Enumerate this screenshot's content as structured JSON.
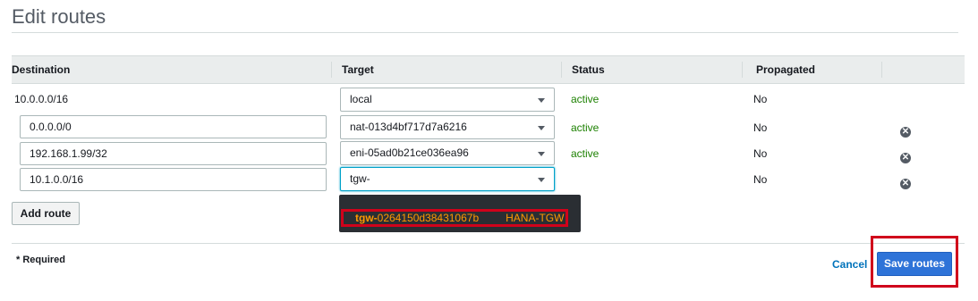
{
  "page": {
    "title": "Edit routes"
  },
  "table": {
    "columns": [
      "Destination",
      "Target",
      "Status",
      "Propagated"
    ],
    "rows": [
      {
        "destination": "10.0.0.0/16",
        "target": "local",
        "status": "active",
        "propagated": "No"
      },
      {
        "destination": "0.0.0.0/0",
        "target": "nat-013d4bf717d7a6216",
        "status": "active",
        "propagated": "No"
      },
      {
        "destination": "192.168.1.99/32",
        "target": "eni-05ad0b21ce036ea96",
        "status": "active",
        "propagated": "No"
      },
      {
        "destination": "10.1.0.0/16",
        "target": "tgw-",
        "status": "",
        "propagated": "No"
      }
    ]
  },
  "dropdown": {
    "prefix": "tgw-",
    "id_rest": "0264150d38431067b",
    "name": "HANA-TGW"
  },
  "buttons": {
    "add_route": "Add route",
    "cancel": "Cancel",
    "save_routes": "Save routes"
  },
  "footer": {
    "required_note": "* Required"
  },
  "icons": {
    "remove": "remove-circle-x-icon",
    "caret": "caret-down-icon"
  }
}
